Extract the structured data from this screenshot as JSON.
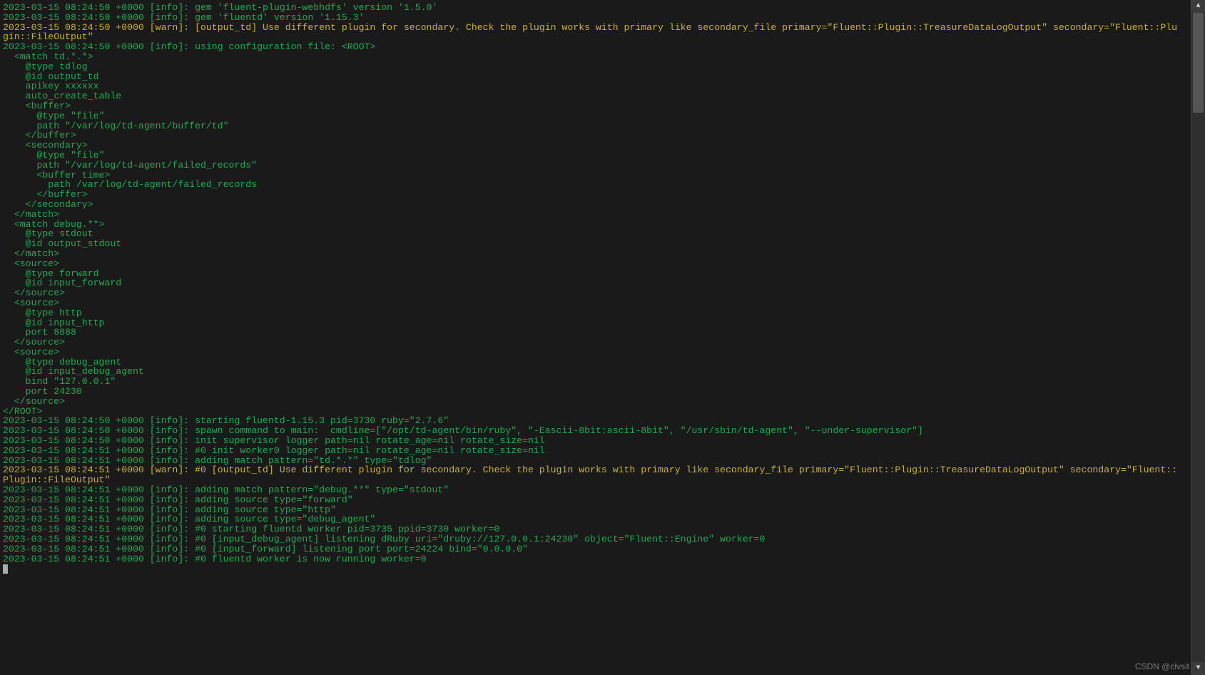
{
  "lines": [
    {
      "cls": "info",
      "text": "2023-03-15 08:24:50 +0000 [info]: gem 'fluent-plugin-webhdfs' version '1.5.0'"
    },
    {
      "cls": "info",
      "text": "2023-03-15 08:24:50 +0000 [info]: gem 'fluentd' version '1.15.3'"
    },
    {
      "cls": "warn",
      "text": "2023-03-15 08:24:50 +0000 [warn]: [output_td] Use different plugin for secondary. Check the plugin works with primary like secondary_file primary=\"Fluent::Plugin::TreasureDataLogOutput\" secondary=\"Fluent::Plu"
    },
    {
      "cls": "warn",
      "text": "gin::FileOutput\""
    },
    {
      "cls": "info",
      "text": "2023-03-15 08:24:50 +0000 [info]: using configuration file: <ROOT>"
    },
    {
      "cls": "info",
      "text": "  <match td.*.*>"
    },
    {
      "cls": "info",
      "text": "    @type tdlog"
    },
    {
      "cls": "info",
      "text": "    @id output_td"
    },
    {
      "cls": "info",
      "text": "    apikey xxxxxx"
    },
    {
      "cls": "info",
      "text": "    auto_create_table"
    },
    {
      "cls": "info",
      "text": "    <buffer>"
    },
    {
      "cls": "info",
      "text": "      @type \"file\""
    },
    {
      "cls": "info",
      "text": "      path \"/var/log/td-agent/buffer/td\""
    },
    {
      "cls": "info",
      "text": "    </buffer>"
    },
    {
      "cls": "info",
      "text": "    <secondary>"
    },
    {
      "cls": "info",
      "text": "      @type \"file\""
    },
    {
      "cls": "info",
      "text": "      path \"/var/log/td-agent/failed_records\""
    },
    {
      "cls": "info",
      "text": "      <buffer time>"
    },
    {
      "cls": "info",
      "text": "        path /var/log/td-agent/failed_records"
    },
    {
      "cls": "info",
      "text": "      </buffer>"
    },
    {
      "cls": "info",
      "text": "    </secondary>"
    },
    {
      "cls": "info",
      "text": "  </match>"
    },
    {
      "cls": "info",
      "text": "  <match debug.**>"
    },
    {
      "cls": "info",
      "text": "    @type stdout"
    },
    {
      "cls": "info",
      "text": "    @id output_stdout"
    },
    {
      "cls": "info",
      "text": "  </match>"
    },
    {
      "cls": "info",
      "text": "  <source>"
    },
    {
      "cls": "info",
      "text": "    @type forward"
    },
    {
      "cls": "info",
      "text": "    @id input_forward"
    },
    {
      "cls": "info",
      "text": "  </source>"
    },
    {
      "cls": "info",
      "text": "  <source>"
    },
    {
      "cls": "info",
      "text": "    @type http"
    },
    {
      "cls": "info",
      "text": "    @id input_http"
    },
    {
      "cls": "info",
      "text": "    port 8888"
    },
    {
      "cls": "info",
      "text": "  </source>"
    },
    {
      "cls": "info",
      "text": "  <source>"
    },
    {
      "cls": "info",
      "text": "    @type debug_agent"
    },
    {
      "cls": "info",
      "text": "    @id input_debug_agent"
    },
    {
      "cls": "info",
      "text": "    bind \"127.0.0.1\""
    },
    {
      "cls": "info",
      "text": "    port 24230"
    },
    {
      "cls": "info",
      "text": "  </source>"
    },
    {
      "cls": "info",
      "text": "</ROOT>"
    },
    {
      "cls": "info",
      "text": "2023-03-15 08:24:50 +0000 [info]: starting fluentd-1.15.3 pid=3730 ruby=\"2.7.6\""
    },
    {
      "cls": "info",
      "text": "2023-03-15 08:24:50 +0000 [info]: spawn command to main:  cmdline=[\"/opt/td-agent/bin/ruby\", \"-Eascii-8bit:ascii-8bit\", \"/usr/sbin/td-agent\", \"--under-supervisor\"]"
    },
    {
      "cls": "info",
      "text": "2023-03-15 08:24:50 +0000 [info]: init supervisor logger path=nil rotate_age=nil rotate_size=nil"
    },
    {
      "cls": "info",
      "text": "2023-03-15 08:24:51 +0000 [info]: #0 init worker0 logger path=nil rotate_age=nil rotate_size=nil"
    },
    {
      "cls": "info",
      "text": "2023-03-15 08:24:51 +0000 [info]: adding match pattern=\"td.*.*\" type=\"tdlog\""
    },
    {
      "cls": "warn",
      "text": "2023-03-15 08:24:51 +0000 [warn]: #0 [output_td] Use different plugin for secondary. Check the plugin works with primary like secondary_file primary=\"Fluent::Plugin::TreasureDataLogOutput\" secondary=\"Fluent::"
    },
    {
      "cls": "warn",
      "text": "Plugin::FileOutput\""
    },
    {
      "cls": "info",
      "text": "2023-03-15 08:24:51 +0000 [info]: adding match pattern=\"debug.**\" type=\"stdout\""
    },
    {
      "cls": "info",
      "text": "2023-03-15 08:24:51 +0000 [info]: adding source type=\"forward\""
    },
    {
      "cls": "info",
      "text": "2023-03-15 08:24:51 +0000 [info]: adding source type=\"http\""
    },
    {
      "cls": "info",
      "text": "2023-03-15 08:24:51 +0000 [info]: adding source type=\"debug_agent\""
    },
    {
      "cls": "info",
      "text": "2023-03-15 08:24:51 +0000 [info]: #0 starting fluentd worker pid=3735 ppid=3730 worker=0"
    },
    {
      "cls": "info",
      "text": "2023-03-15 08:24:51 +0000 [info]: #0 [input_debug_agent] listening dRuby uri=\"druby://127.0.0.1:24230\" object=\"Fluent::Engine\" worker=0"
    },
    {
      "cls": "info",
      "text": "2023-03-15 08:24:51 +0000 [info]: #0 [input_forward] listening port port=24224 bind=\"0.0.0.0\""
    },
    {
      "cls": "info",
      "text": "2023-03-15 08:24:51 +0000 [info]: #0 fluentd worker is now running worker=0"
    }
  ],
  "watermark": "CSDN @clvsit"
}
